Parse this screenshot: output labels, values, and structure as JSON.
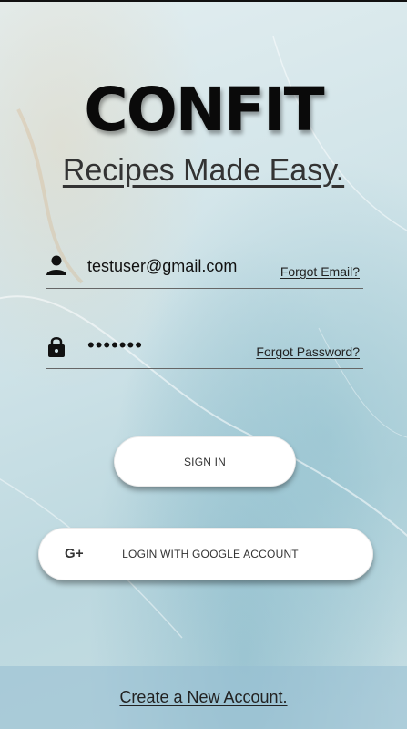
{
  "brand": {
    "logo": "CONFIT",
    "tagline": "Recipes Made Easy."
  },
  "login": {
    "email": {
      "value": "testuser@gmail.com",
      "icon": "person-icon",
      "forgot_label": "Forgot Email?"
    },
    "password": {
      "value": "•••••••",
      "icon": "lock-icon",
      "forgot_label": "Forgot Password?"
    },
    "sign_in_label": "SIGN IN",
    "google": {
      "icon": "google-plus-icon",
      "icon_glyph": "G+",
      "label": "LOGIN WITH GOOGLE ACCOUNT"
    }
  },
  "footer": {
    "create_account_label": "Create a New Account."
  },
  "colors": {
    "text": "#111111",
    "button_bg": "#ffffff",
    "footer_bg": "#9bbfd2"
  }
}
